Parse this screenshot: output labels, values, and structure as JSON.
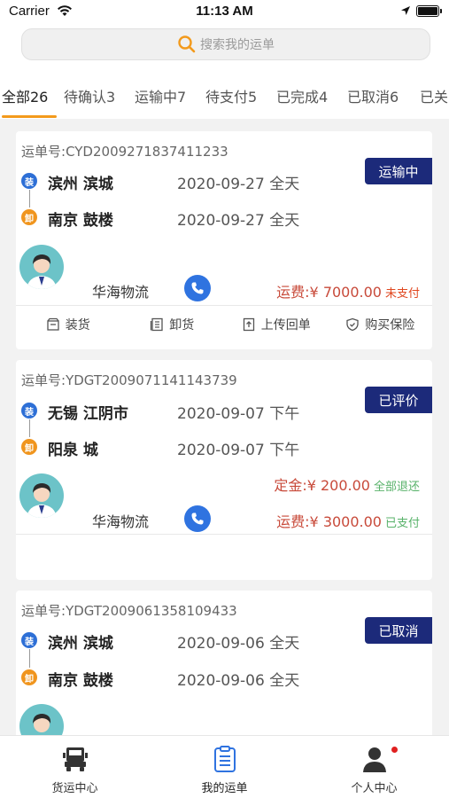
{
  "status_bar": {
    "carrier": "Carrier",
    "time": "11:13 AM"
  },
  "search": {
    "placeholder": "搜索我的运单"
  },
  "tabs": [
    {
      "label": "全部26",
      "active": true
    },
    {
      "label": "待确认3",
      "active": false
    },
    {
      "label": "运输中7",
      "active": false
    },
    {
      "label": "待支付5",
      "active": false
    },
    {
      "label": "已完成4",
      "active": false
    },
    {
      "label": "已取消6",
      "active": false
    },
    {
      "label": "已关",
      "active": false
    }
  ],
  "waybill_prefix": "运单号:",
  "load_badge": "装",
  "unload_badge": "卸",
  "orders": [
    {
      "number": "CYD2009271837411233",
      "status": "运输中",
      "from_city": "滨州 滨城",
      "from_date": "2020-09-27 全天",
      "to_city": "南京 鼓楼",
      "to_date": "2020-09-27 全天",
      "company": "华海物流",
      "freight_label": "运费:",
      "freight_amount": "¥ 7000.00",
      "freight_status": "未支付",
      "actions": [
        "装货",
        "卸货",
        "上传回单",
        "购买保险"
      ]
    },
    {
      "number": "YDGT2009071141143739",
      "status": "已评价",
      "from_city": "无锡 江阴市",
      "from_date": "2020-09-07 下午",
      "to_city": "阳泉 城",
      "to_date": "2020-09-07 下午",
      "company": "华海物流",
      "deposit_label": "定金:",
      "deposit_amount": "¥ 200.00",
      "deposit_status": "全部退还",
      "freight_label": "运费:",
      "freight_amount": "¥ 3000.00",
      "freight_status": "已支付"
    },
    {
      "number": "YDGT2009061358109433",
      "status": "已取消",
      "from_city": "滨州 滨城",
      "from_date": "2020-09-06 全天",
      "to_city": "南京 鼓楼",
      "to_date": "2020-09-06 全天"
    }
  ],
  "tabbar": [
    {
      "label": "货运中心",
      "icon": "truck-icon"
    },
    {
      "label": "我的运单",
      "icon": "clipboard-icon",
      "active": true
    },
    {
      "label": "个人中心",
      "icon": "person-icon",
      "badge": true
    }
  ],
  "colors": {
    "accent": "#f39a1c",
    "status_tag": "#1c2a7a",
    "load": "#2d6fd6",
    "unload": "#f0951e",
    "fee": "#c84a3a",
    "unpaid": "#e0471f",
    "paid": "#58b26a"
  }
}
